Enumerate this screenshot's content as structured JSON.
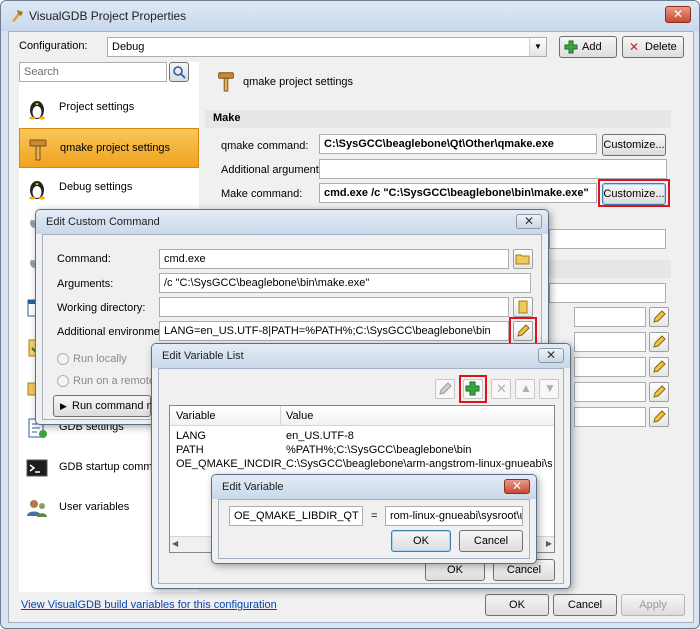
{
  "window": {
    "title": "VisualGDB Project Properties",
    "close_label": "✕"
  },
  "configuration": {
    "label": "Configuration:",
    "value": "Debug",
    "add_label": "Add",
    "delete_label": "Delete"
  },
  "search": {
    "placeholder": "Search"
  },
  "sidebar": {
    "items": [
      {
        "label": "Project settings",
        "icon": "linux-penguin-icon"
      },
      {
        "label": "qmake project settings",
        "icon": "hammer-icon",
        "active": true
      },
      {
        "label": "Debug settings",
        "icon": "linux-penguin-icon"
      },
      {
        "label": "GDB settings",
        "icon": "gdb-icon"
      },
      {
        "label": "GDB startup commands",
        "icon": "console-icon"
      },
      {
        "label": "User variables",
        "icon": "users-icon"
      }
    ]
  },
  "main": {
    "page_title": "qmake project settings",
    "section_make": "Make",
    "qmake_command_label": "qmake command:",
    "qmake_command_value": "C:\\SysGCC\\beaglebone\\Qt\\Other\\qmake.exe",
    "additional_args_label": "Additional arguments:",
    "additional_args_value": "",
    "make_command_label": "Make command:",
    "make_command_value": "cmd.exe /c \"C:\\SysGCC\\beaglebone\\bin\\make.exe\"",
    "customize_label": "Customize..."
  },
  "footer": {
    "link": "View VisualGDB build variables for this configuration",
    "ok_label": "OK",
    "cancel_label": "Cancel",
    "apply_label": "Apply"
  },
  "custom_command_dialog": {
    "title": "Edit Custom Command",
    "command_label": "Command:",
    "command_value": "cmd.exe",
    "arguments_label": "Arguments:",
    "arguments_value": "/c \"C:\\SysGCC\\beaglebone\\bin\\make.exe\"",
    "working_dir_label": "Working directory:",
    "working_dir_value": "",
    "env_label": "Additional environment:",
    "env_value": "LANG=en_US.UTF-8|PATH=%PATH%;C:\\SysGCC\\beaglebone\\bin",
    "run_locally_label": "Run locally",
    "run_remote_label": "Run on a remote co",
    "run_now_label": "Run command now"
  },
  "variable_list_dialog": {
    "title": "Edit Variable List",
    "col_variable": "Variable",
    "col_value": "Value",
    "rows": [
      {
        "variable": "LANG",
        "value": "en_US.UTF-8"
      },
      {
        "variable": "PATH",
        "value": "%PATH%;C:\\SysGCC\\beaglebone\\bin"
      },
      {
        "variable": "OE_QMAKE_INCDIR_QT",
        "value": "C:\\SysGCC\\beaglebone\\arm-angstrom-linux-gnueabi\\sysroot\\usr\\in"
      }
    ],
    "ok_label": "OK",
    "cancel_label": "Cancel"
  },
  "edit_variable_dialog": {
    "title": "Edit Variable",
    "name_value": "OE_QMAKE_LIBDIR_QT",
    "equals": "=",
    "value_value": "rom-linux-gnueabi\\sysroot\\usr\\lib",
    "ok_label": "OK",
    "cancel_label": "Cancel"
  },
  "colors": {
    "highlight": "#e0121d",
    "active_nav": "#f0a31e",
    "link": "#0645ad"
  }
}
